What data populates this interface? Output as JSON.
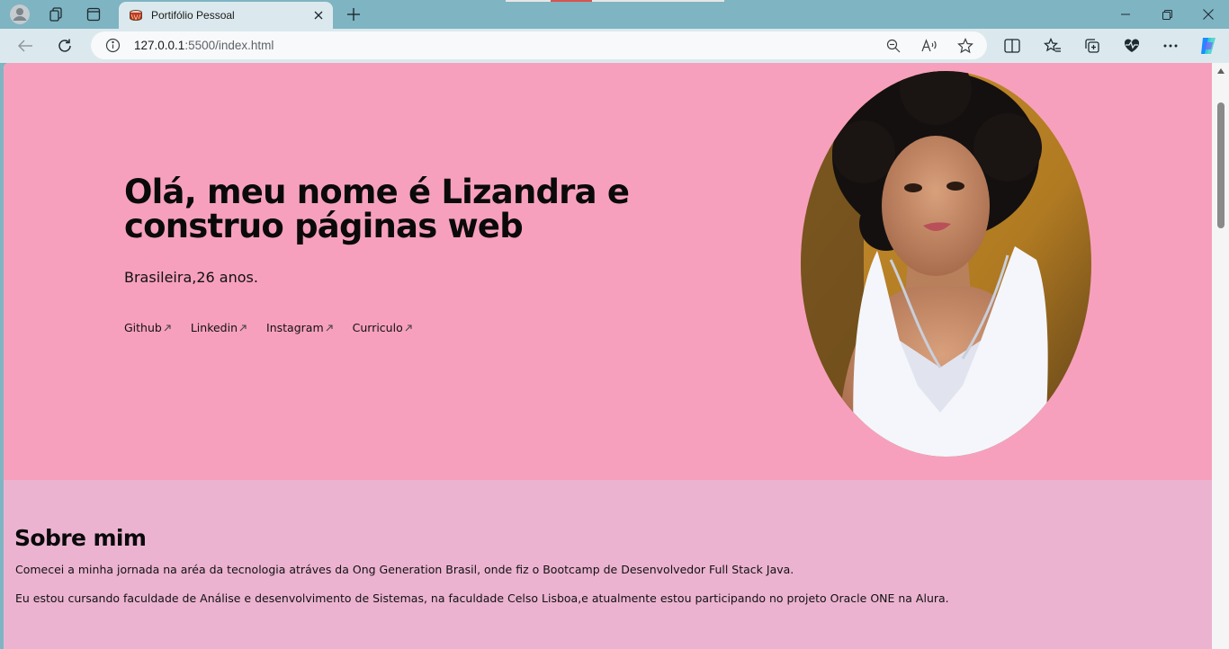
{
  "browser": {
    "tab_title": "Portifólio Pessoal",
    "url_host": "127.0.0.1",
    "url_rest": ":5500/index.html"
  },
  "hero": {
    "heading": "Olá, meu nome é Lizandra e construo páginas web",
    "subtitle": "Brasileira,26 anos.",
    "links": [
      {
        "label": "Github"
      },
      {
        "label": "Linkedin"
      },
      {
        "label": "Instagram"
      },
      {
        "label": "Curriculo"
      }
    ]
  },
  "about": {
    "heading": "Sobre mim",
    "paragraph1": "Comecei a minha jornada na aréa da tecnologia atráves da Ong Generation Brasil, onde fiz o Bootcamp de Desenvolvedor Full Stack Java.",
    "paragraph2": "Eu estou cursando faculdade de Análise e desenvolvimento de Sistemas, na faculdade Celso Lisboa,e atualmente estou participando no projeto Oracle ONE na Alura."
  },
  "colors": {
    "hero_bg": "#f7a0bd",
    "about_bg": "#ecb3d1",
    "browser_frame": "#7fb4c2"
  }
}
